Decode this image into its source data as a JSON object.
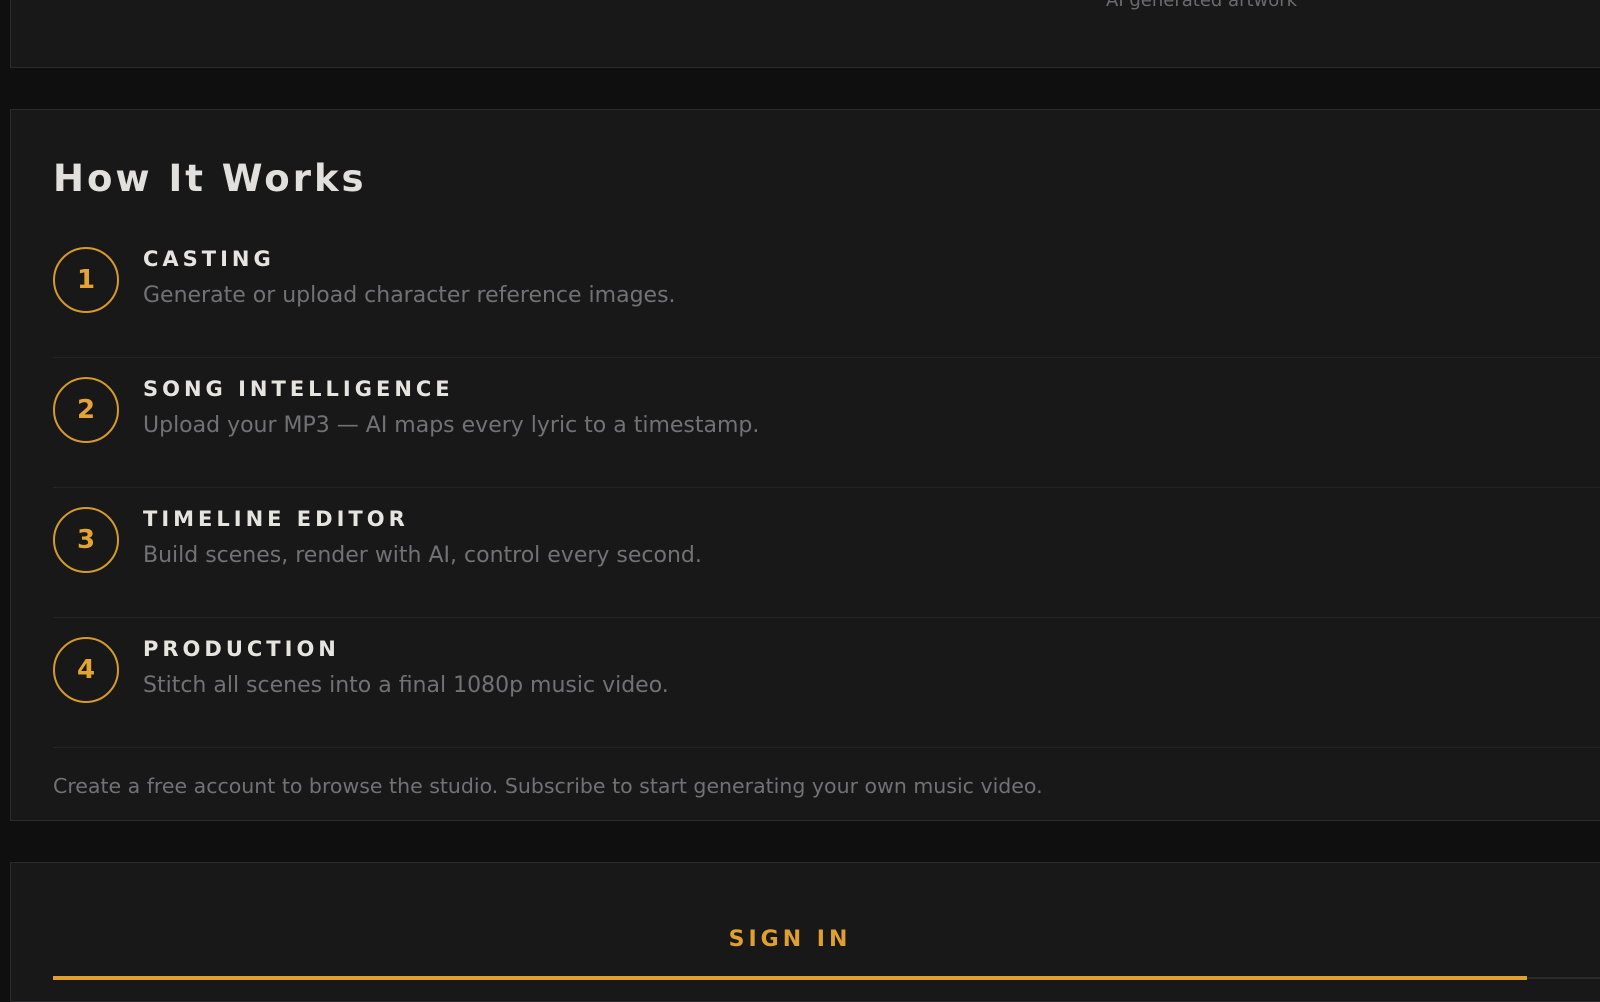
{
  "top": {
    "caption": "AI generated artwork"
  },
  "how_it_works": {
    "title": "How It Works",
    "steps": [
      {
        "number": "1",
        "title": "CASTING",
        "description": "Generate or upload character reference images."
      },
      {
        "number": "2",
        "title": "SONG INTELLIGENCE",
        "description": "Upload your MP3 — AI maps every lyric to a timestamp."
      },
      {
        "number": "3",
        "title": "TIMELINE EDITOR",
        "description": "Build scenes, render with AI, control every second."
      },
      {
        "number": "4",
        "title": "PRODUCTION",
        "description": "Stitch all scenes into a final 1080p music video."
      }
    ],
    "note": "Create a free account to browse the studio. Subscribe to start generating your own music video."
  },
  "auth": {
    "active_tab": "SIGN IN"
  },
  "colors": {
    "accent": "#e0a030",
    "background": "#0f0f10",
    "panel": "#181819",
    "text_primary": "#e6e4df",
    "text_muted": "#727275"
  }
}
